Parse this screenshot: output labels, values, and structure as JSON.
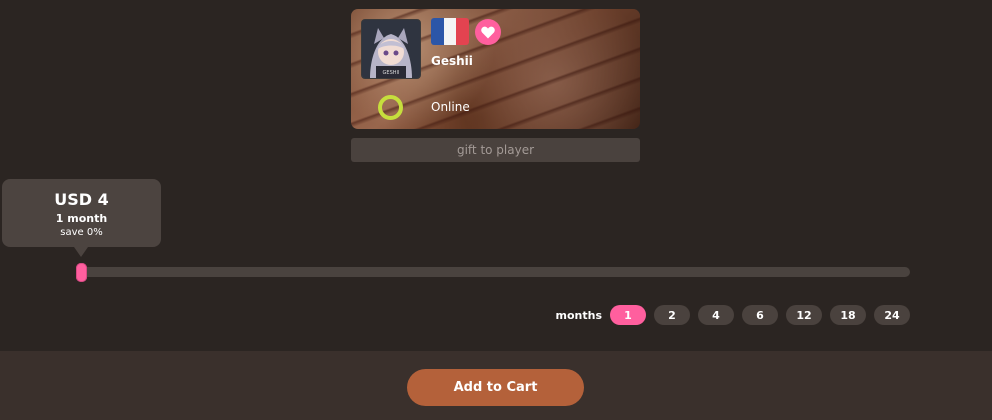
{
  "player": {
    "name": "Geshii",
    "status": "Online",
    "flag_colors": [
      "#2c56a8",
      "#f4f4f4",
      "#e34350"
    ],
    "status_color": "#c6de3d",
    "avatar_caption": "GESHII"
  },
  "gift_label": "gift to player",
  "tooltip": {
    "price": "USD 4",
    "duration": "1 month",
    "save": "save 0%"
  },
  "slider": {
    "value_months": 1
  },
  "months": {
    "label": "months",
    "options": [
      "1",
      "2",
      "4",
      "6",
      "12",
      "18",
      "24"
    ],
    "selected": "1"
  },
  "cart_label": "Add to Cart",
  "colors": {
    "accent": "#ff5f9e",
    "cart": "#b4613a",
    "background": "#2b2522"
  }
}
